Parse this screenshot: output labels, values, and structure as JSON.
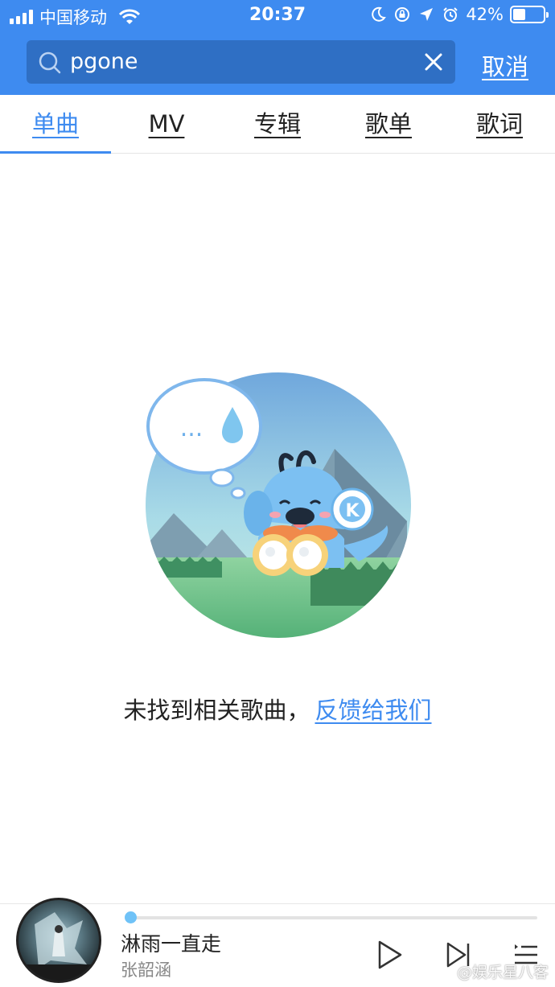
{
  "status_bar": {
    "carrier": "中国移动",
    "time": "20:37",
    "battery_percent": "42%",
    "battery_level": 0.42
  },
  "search": {
    "query": "pgone",
    "cancel_label": "取消"
  },
  "tabs": [
    {
      "label": "单曲",
      "active": true
    },
    {
      "label": "MV",
      "active": false
    },
    {
      "label": "专辑",
      "active": false
    },
    {
      "label": "歌单",
      "active": false
    },
    {
      "label": "歌词",
      "active": false
    }
  ],
  "empty_state": {
    "message": "未找到相关歌曲，",
    "feedback_link": "反馈给我们",
    "bubble_text": "..."
  },
  "player": {
    "song_title": "淋雨一直走",
    "artist": "张韶涵",
    "progress": 0.01
  },
  "watermark": "@娱乐星八客",
  "colors": {
    "accent": "#3e8bf0",
    "search_box": "#2f6fc4",
    "progress": "#6fc2f7"
  }
}
